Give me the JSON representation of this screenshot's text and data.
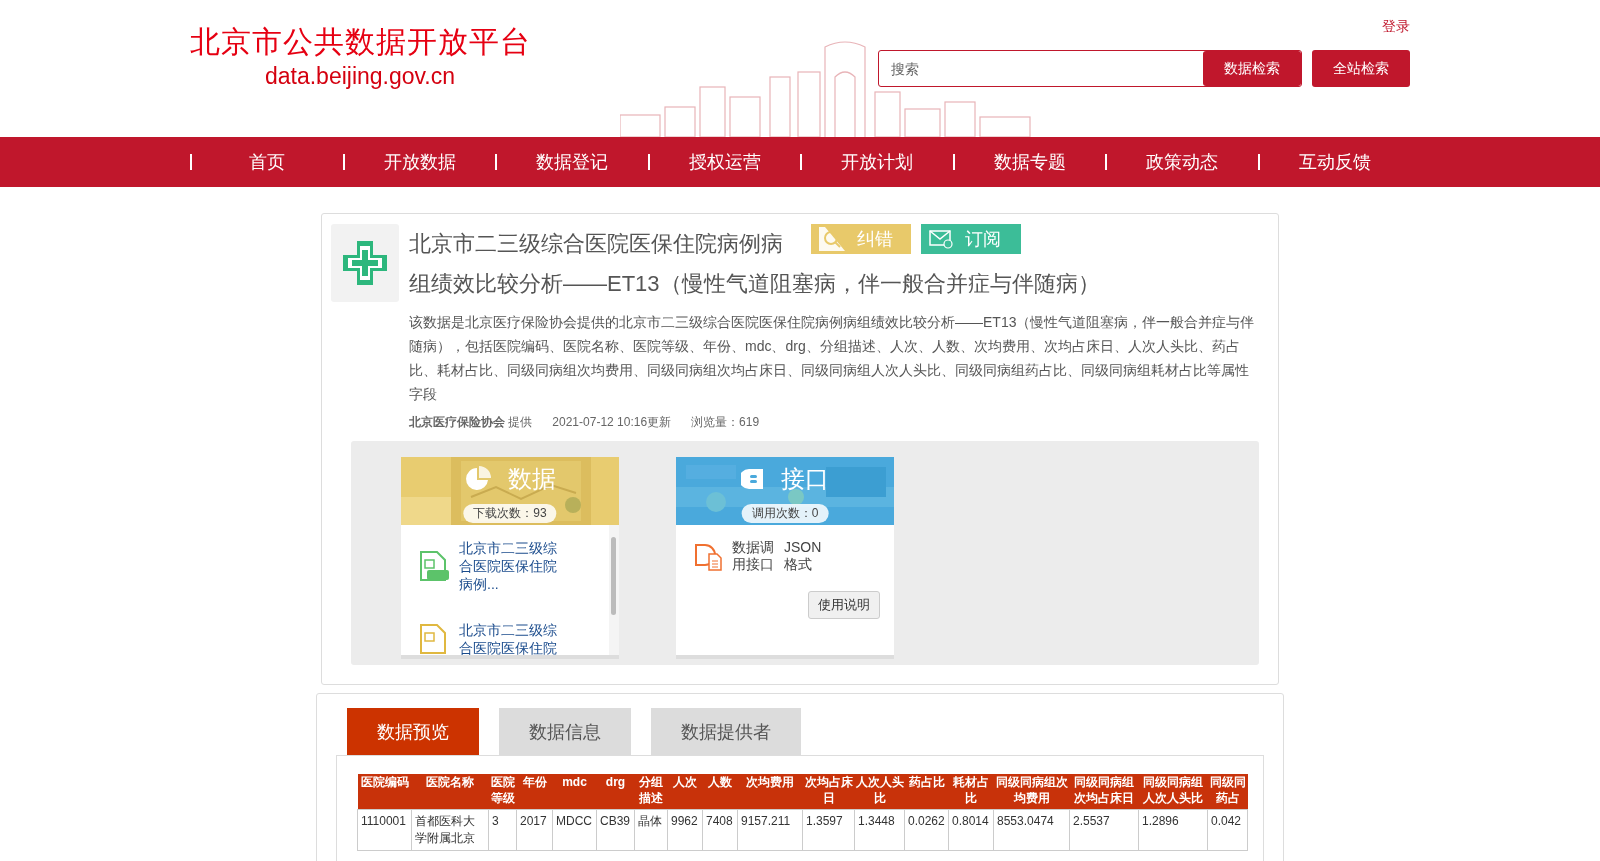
{
  "header": {
    "logo_title": "北京市公共数据开放平台",
    "logo_url": "data.beijing.gov.cn",
    "login": "登录",
    "search_placeholder": "搜索",
    "search_button": "数据检索",
    "site_search_button": "全站检索"
  },
  "nav": [
    "首页",
    "开放数据",
    "数据登记",
    "授权运营",
    "开放计划",
    "数据专题",
    "政策动态",
    "互动反馈"
  ],
  "dataset": {
    "title_lines": [
      "北京市二三级综合医院医保住院病例病",
      "组绩效比较分析——ET13（慢性气道阻塞病，伴一般合并症与伴随病）"
    ],
    "actions": [
      {
        "label": "纠错",
        "kind": "report"
      },
      {
        "label": "订阅",
        "kind": "subscribe"
      }
    ],
    "description": "该数据是北京医疗保险协会提供的北京市二三级综合医院医保住院病例病组绩效比较分析——ET13（慢性气道阻塞病，伴一般合并症与伴随病），包括医院编码、医院名称、医院等级、年份、mdc、drg、分组描述、人次、人数、次均费用、次均占床日、人次人头比、药占比、耗材占比、同级同病组次均费用、同级同病组次均占床日、同级同病组人次人头比、同级同病组药占比、同级同病组耗材占比等属性字段",
    "provider": "北京医疗保险协会",
    "provider_suffix": "提供",
    "updated": "2021-07-12 10:16更新",
    "views": "浏览量：619"
  },
  "data_card": {
    "title": "数据",
    "count": "下载次数：93",
    "files": [
      {
        "name": "北京市二三级综合医院医保住院病例...",
        "kind": "xls"
      },
      {
        "name": "北京市二三级综合医院医保住院",
        "kind": "other"
      }
    ]
  },
  "api_card": {
    "title": "接口",
    "count": "调用次数：0",
    "items": [
      "数据调用接口",
      "JSON格式"
    ],
    "button": "使用说明"
  },
  "tabs": [
    {
      "label": "数据预览",
      "selected": true
    },
    {
      "label": "数据信息",
      "selected": false
    },
    {
      "label": "数据提供者",
      "selected": false
    }
  ],
  "table": {
    "columns": [
      "医院编码",
      "医院名称",
      "医院等级",
      "年份",
      "mdc",
      "drg",
      "分组描述",
      "人次",
      "人数",
      "次均费用",
      "次均占床日",
      "人次人头比",
      "药占比",
      "耗材占比",
      "同级同病组次均费用",
      "同级同病组次均占床日",
      "同级同病组人次人头比",
      "同级同药占"
    ],
    "rows": [
      [
        "1110001",
        "首都医科大学附属北京",
        "3",
        "2017",
        "MDCC",
        "CB39",
        "晶体",
        "9962",
        "7408",
        "9157.211",
        "1.3597",
        "1.3448",
        "0.0262",
        "0.8014",
        "8553.0474",
        "2.5537",
        "1.2896",
        "0.042"
      ]
    ]
  }
}
